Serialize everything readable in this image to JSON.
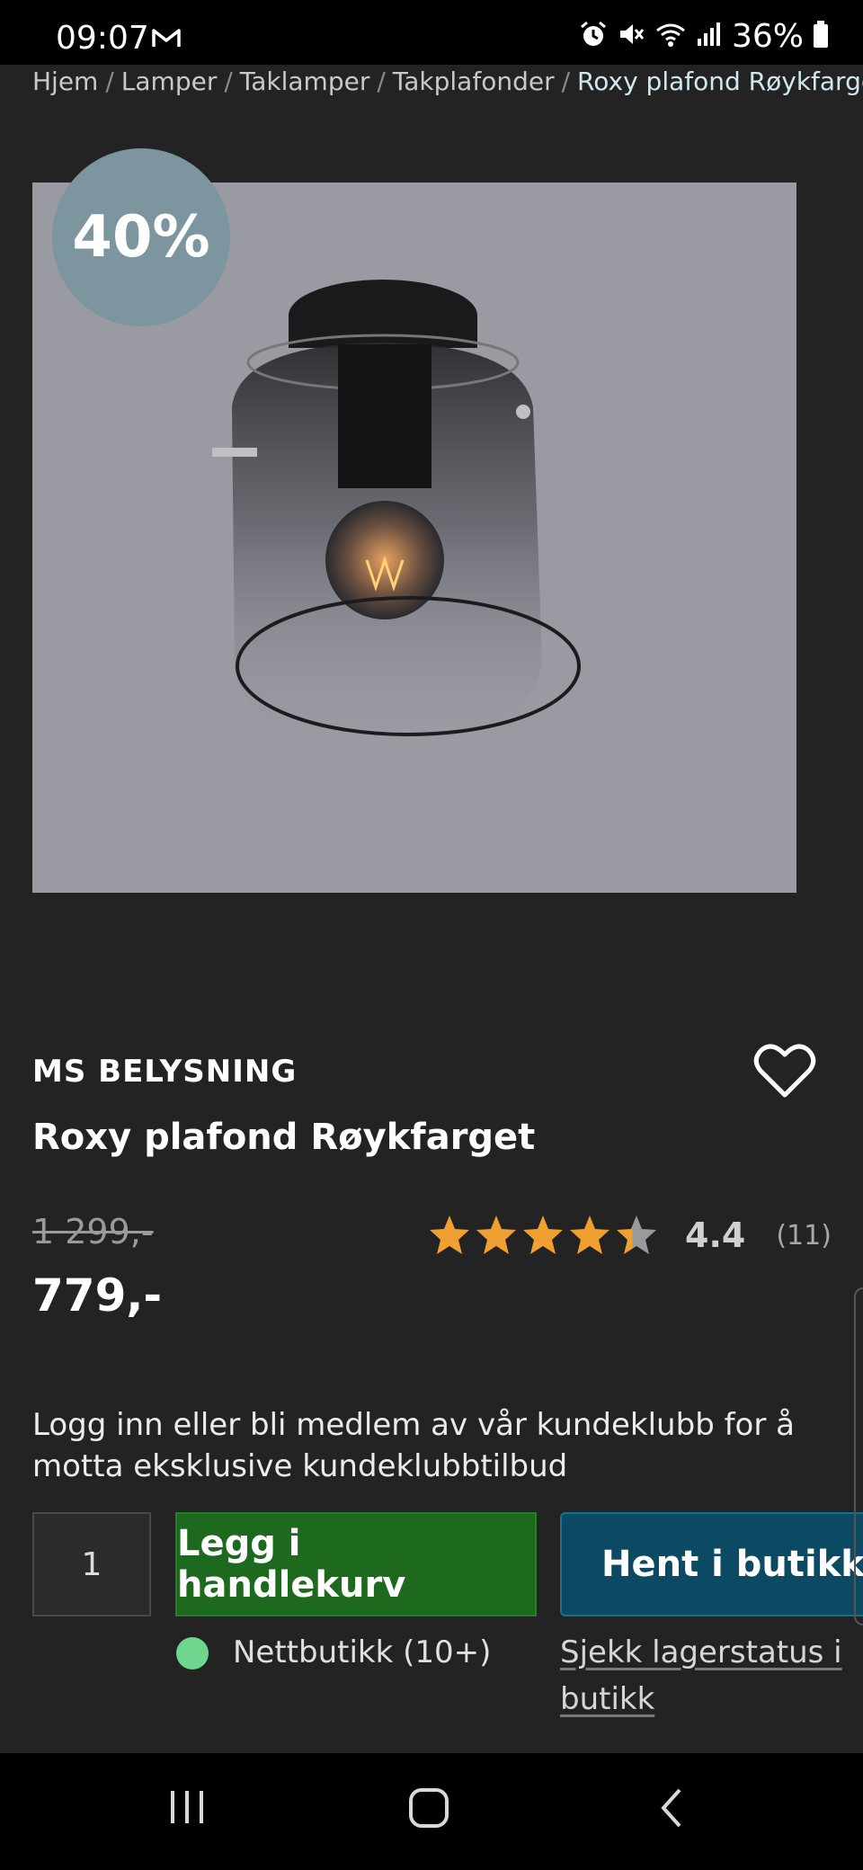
{
  "status_bar": {
    "time": "09:07",
    "battery": "36%"
  },
  "breadcrumb": {
    "items": [
      "Hjem",
      "Lamper",
      "Taklamper",
      "Takplafonder"
    ],
    "current": "Roxy plafond Røykfarget",
    "separator": "/"
  },
  "product": {
    "discount": "40%",
    "brand": "MS BELYSNING",
    "title": "Roxy plafond Røykfarget",
    "old_price": "1 299,-",
    "price": "779,-",
    "rating": {
      "score": "4.4",
      "count": "(11)",
      "stars": 4.4
    }
  },
  "member_text": "Logg inn eller bli medlem av vår kundeklubb for å motta eksklusive kundeklubbtilbud",
  "purchase": {
    "quantity": "1",
    "add_to_cart": "Legg i handlekurv",
    "pickup": "Hent i butikk",
    "stock_status": "Nettbutikk (10+)",
    "check_stock": "Sjekk lagerstatus i butikk"
  },
  "colors": {
    "background": "#232323",
    "add_to_cart": "#1d6a1f",
    "pickup": "#0c4a63",
    "star": "#f0a030",
    "badge": "#7d959e",
    "stock_dot": "#6fd68f"
  },
  "icons": [
    "mail-icon",
    "alarm-icon",
    "mute-icon",
    "wifi-icon",
    "signal-icon",
    "battery-icon",
    "heart-icon",
    "star-icon",
    "recent-apps-icon",
    "home-icon",
    "back-icon"
  ]
}
